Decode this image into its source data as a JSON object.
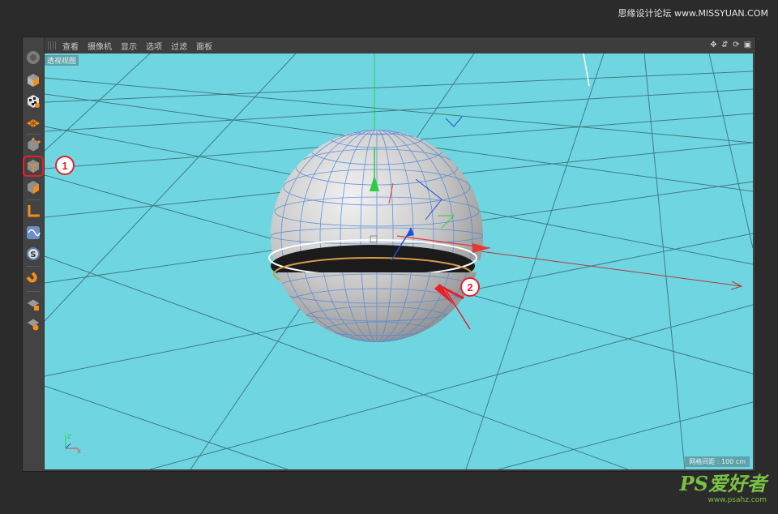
{
  "watermark": {
    "top_text": "思缘设计论坛 www.MISSYUAN.COM",
    "logo_text": "PS爱好者",
    "logo_url": "www.psahz.com"
  },
  "menubar": {
    "items": [
      "查看",
      "摄像机",
      "显示",
      "选项",
      "过滤",
      "面板"
    ]
  },
  "viewport": {
    "label": "透视视图",
    "grid_spacing": "网格间距 : 100 cm",
    "background_color": "#6fd6e1"
  },
  "toolbar": {
    "tools": [
      {
        "icon": "model-mode-icon"
      },
      {
        "icon": "texture-mode-icon"
      },
      {
        "icon": "workplane-mode-icon"
      },
      {
        "icon": "points-mode-icon"
      },
      {
        "icon": "edges-mode-icon",
        "active": true
      },
      {
        "icon": "polygons-mode-icon"
      },
      {
        "icon": "axis-mode-icon"
      },
      {
        "icon": "tweak-mode-icon"
      },
      {
        "icon": "solo-icon"
      },
      {
        "icon": "snap-magnet-icon"
      },
      {
        "icon": "workplane-lock-icon"
      },
      {
        "icon": "planar-workplane-icon"
      }
    ]
  },
  "callouts": [
    "1",
    "2"
  ],
  "colors": {
    "highlight_red": "#e8202a",
    "ui_dark": "#3c3c3c",
    "axis_x": "#e53935",
    "axis_y": "#2ecc40",
    "axis_z": "#1e4fd8"
  }
}
